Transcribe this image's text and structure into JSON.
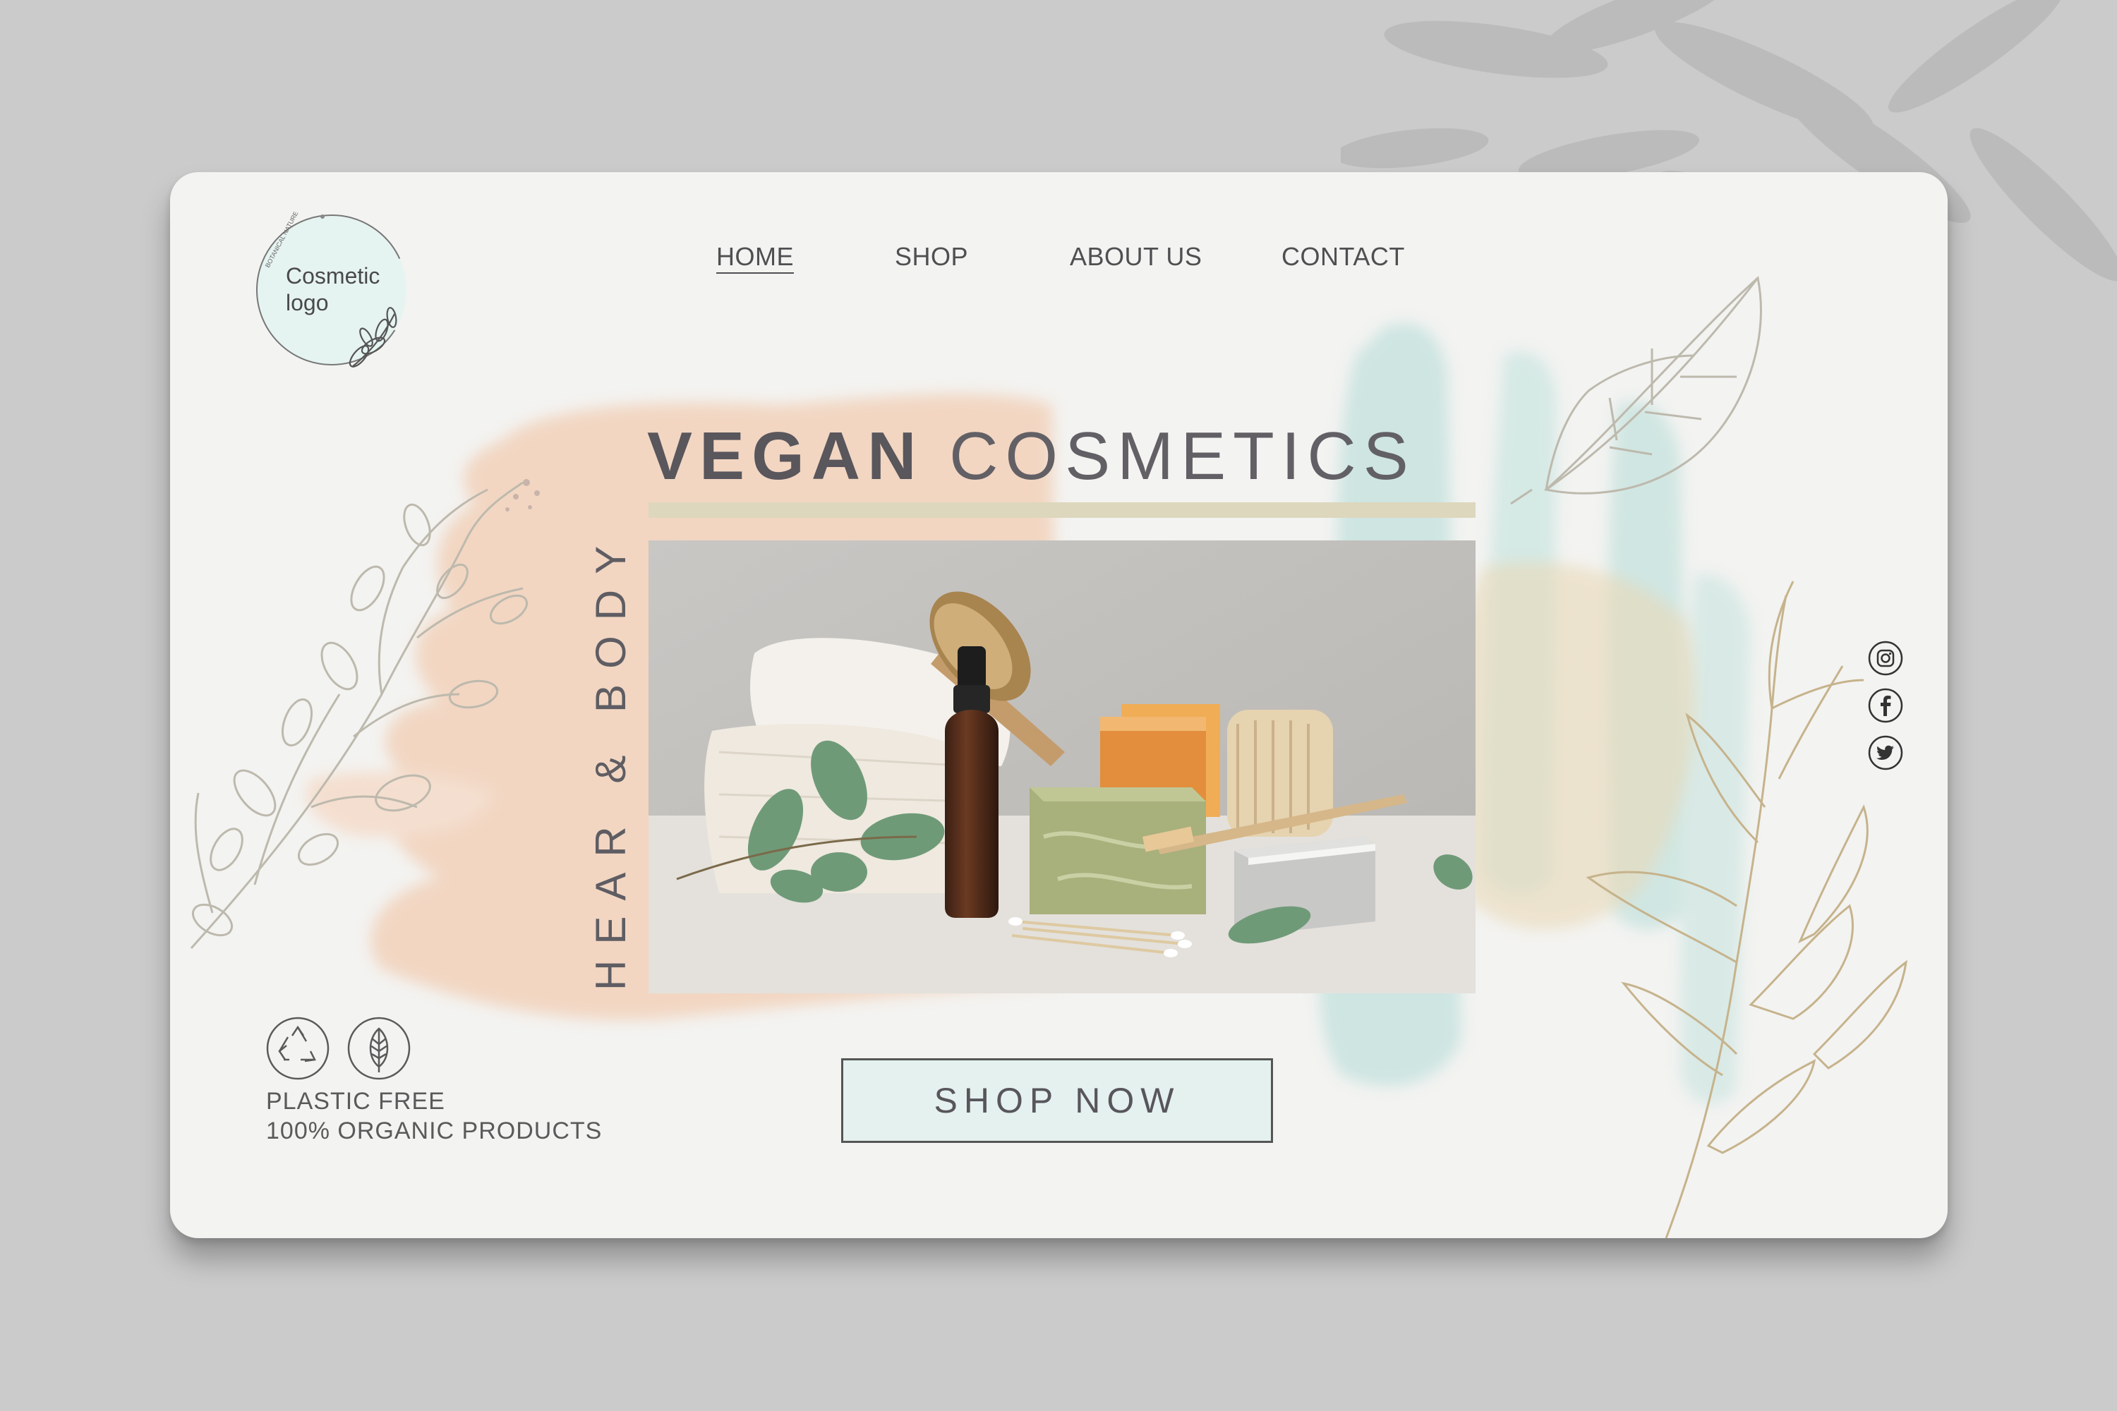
{
  "brand": {
    "logo_text": "Cosmetic\nlogo",
    "logo_arc_text": "BOTANICAL NATURE"
  },
  "nav": {
    "items": [
      {
        "label": "HOME",
        "active": true
      },
      {
        "label": "SHOP",
        "active": false
      },
      {
        "label": "ABOUT US",
        "active": false
      },
      {
        "label": "CONTACT",
        "active": false
      }
    ]
  },
  "hero": {
    "headline_bold": "VEGAN",
    "headline_light": "COSMETICS",
    "vertical_text": "HEAR & BODY",
    "cta_label": "SHOP NOW"
  },
  "badges": {
    "line1": "PLASTIC FREE",
    "line2": "100% ORGANIC PRODUCTS",
    "icons": [
      "recycle-icon",
      "leaf-icon"
    ]
  },
  "social": {
    "icons": [
      "instagram-icon",
      "facebook-icon",
      "twitter-icon"
    ]
  },
  "colors": {
    "page_bg": "#cbcbcb",
    "card_bg": "#f3f3f1",
    "peach_wash": "#f2cdb3",
    "mint_wash": "#bfe0dc",
    "beige_bar": "#ddd7bd",
    "text": "#59565c",
    "button_fill": "#e4f1ef"
  }
}
